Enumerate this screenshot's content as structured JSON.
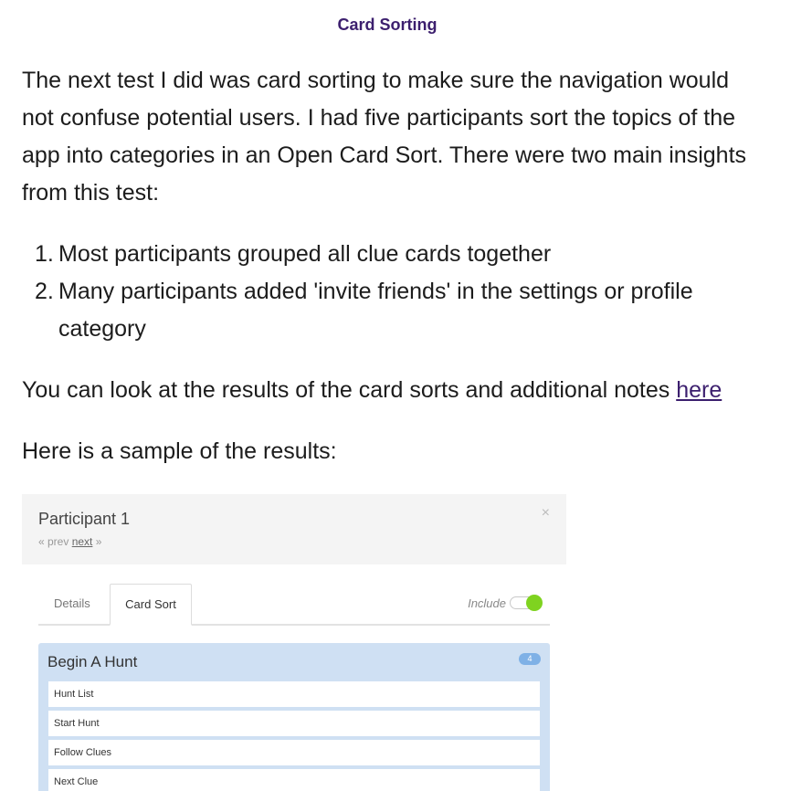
{
  "heading": "Card Sorting",
  "intro": "The next test I did was card sorting to make sure the navigation would not confuse potential users. I had five participants sort the topics of the app into categories in an Open Card Sort. There were two main insights from this test:",
  "insights": [
    "Most participants grouped all clue cards together",
    "Many participants added 'invite friends' in the settings or profile category"
  ],
  "results_text": "You can look at the results of the card sorts and additional notes ",
  "results_link": "here",
  "sample_text": "Here is a sample of the results:",
  "screenshot": {
    "participant": "Participant 1",
    "prev": "« prev",
    "next": "next",
    "next_arrow": "»",
    "close": "×",
    "tabs": [
      "Details",
      "Card Sort"
    ],
    "include_label": "Include",
    "include_on": true,
    "group": {
      "title": "Begin A Hunt",
      "count": "4",
      "cards": [
        "Hunt List",
        "Start Hunt",
        "Follow Clues",
        "Next Clue"
      ]
    },
    "colors": {
      "toggle_on": "#7fd320",
      "group_bg": "#cfe0f3",
      "badge": "#7fb1e6"
    }
  }
}
